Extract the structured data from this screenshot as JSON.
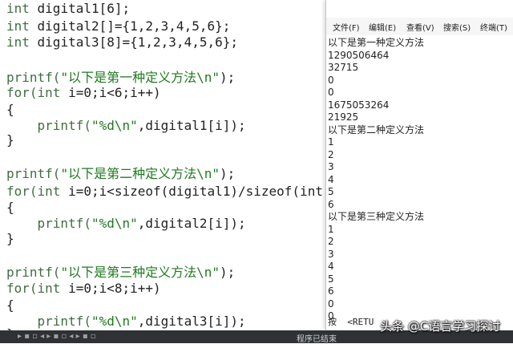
{
  "editor": {
    "lines": [
      {
        "kw": "int",
        "rest": " digital1[6];"
      },
      {
        "kw": "int",
        "rest": " digital2[]={1,2,3,4,5,6};"
      },
      {
        "kw": "int",
        "rest": " digital3[8]={1,2,3,4,5,6};"
      },
      {
        "kw": "printf(",
        "str": "\"以下是第一种定义方法\\n\"",
        "rest": ");"
      },
      {
        "kw": "for(int",
        "rest": " i=0;i<6;i++)"
      },
      {
        "rest": "{"
      },
      {
        "kw": "    printf(",
        "str": "\"%d\\n\"",
        "rest": ",digital1[i]);"
      },
      {
        "rest": "}"
      },
      {
        "kw": "printf(",
        "str": "\"以下是第二种定义方法\\n\"",
        "rest": ");"
      },
      {
        "kw": "for(int",
        "rest": " i=0;i<sizeof(digital1)/sizeof(int)"
      },
      {
        "rest": "{"
      },
      {
        "kw": "    printf(",
        "str": "\"%d\\n\"",
        "rest": ",digital2[i]);"
      },
      {
        "rest": "}"
      },
      {
        "kw": "printf(",
        "str": "\"以下是第三种定义方法\\n\"",
        "rest": ");"
      },
      {
        "kw": "for(int",
        "rest": " i=0;i<8;i++)"
      },
      {
        "rest": "{"
      },
      {
        "kw": "    printf(",
        "str": "\"%d\\n\"",
        "rest": ",digital3[i]);"
      },
      {
        "rest": "}"
      }
    ]
  },
  "terminal": {
    "menu": [
      "文件(F)",
      "编辑(E)",
      "查看(V)",
      "搜索(S)",
      "终端(T)"
    ],
    "output": [
      "以下是第一种定义方法",
      "1290506464",
      "32715",
      "0",
      "0",
      "1675053264",
      "21925",
      "以下是第二种定义方法",
      "1",
      "2",
      "3",
      "4",
      "5",
      "6",
      "以下是第三种定义方法",
      "1",
      "2",
      "3",
      "4",
      "5",
      "6",
      "0",
      "0"
    ],
    "prompt": "按  <RETU"
  },
  "bottombar": {
    "glyphs": "▸ ▪ ▫ ◂ ▸ ▪ ▫ ◂ ▸ ▪ ▫",
    "status": "程序已结束"
  },
  "watermark": "头条 @C语言学习探讨"
}
